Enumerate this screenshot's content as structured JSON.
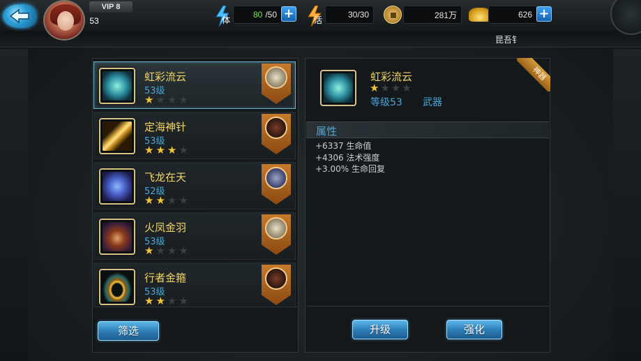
{
  "player": {
    "vip": "VIP 8",
    "level": "53"
  },
  "resources": {
    "stamina_label": "体",
    "stamina_value": "80",
    "stamina_max": "/50",
    "vitality_label": "活",
    "vitality_value": "30/30",
    "copper_value": "281万",
    "gold_value": "626"
  },
  "server_name": "昆吾钅",
  "equipment_list": [
    {
      "name": "虹彩流云",
      "level": "53级",
      "stars": 1,
      "total_stars": 4,
      "icon": "jade-dragon-bracer-icon",
      "selected": true
    },
    {
      "name": "定海神针",
      "level": "53级",
      "stars": 3,
      "total_stars": 4,
      "icon": "golden-staff-icon",
      "selected": false
    },
    {
      "name": "飞龙在天",
      "level": "52级",
      "stars": 2,
      "total_stars": 4,
      "icon": "dragon-polearm-icon",
      "selected": false
    },
    {
      "name": "火凤金羽",
      "level": "53级",
      "stars": 1,
      "total_stars": 4,
      "icon": "hooded-figure-icon",
      "selected": false
    },
    {
      "name": "行者金箍",
      "level": "53级",
      "stars": 2,
      "total_stars": 4,
      "icon": "golden-circlet-icon",
      "selected": false
    }
  ],
  "filter_button": "筛选",
  "detail": {
    "name": "虹彩流云",
    "stars": 1,
    "total_stars": 4,
    "level": "等级53",
    "type": "武器",
    "ribbon": "神器",
    "attr_title": "属性",
    "attributes": [
      "+6337 生命值",
      "+4306 法术强度",
      "+3.00% 生命回复"
    ]
  },
  "buttons": {
    "upgrade": "升级",
    "enhance": "强化"
  },
  "colors": {
    "accent_blue": "#4aa7d8",
    "name_gold": "#f1d56b",
    "star_gold": "#f3c33c"
  }
}
